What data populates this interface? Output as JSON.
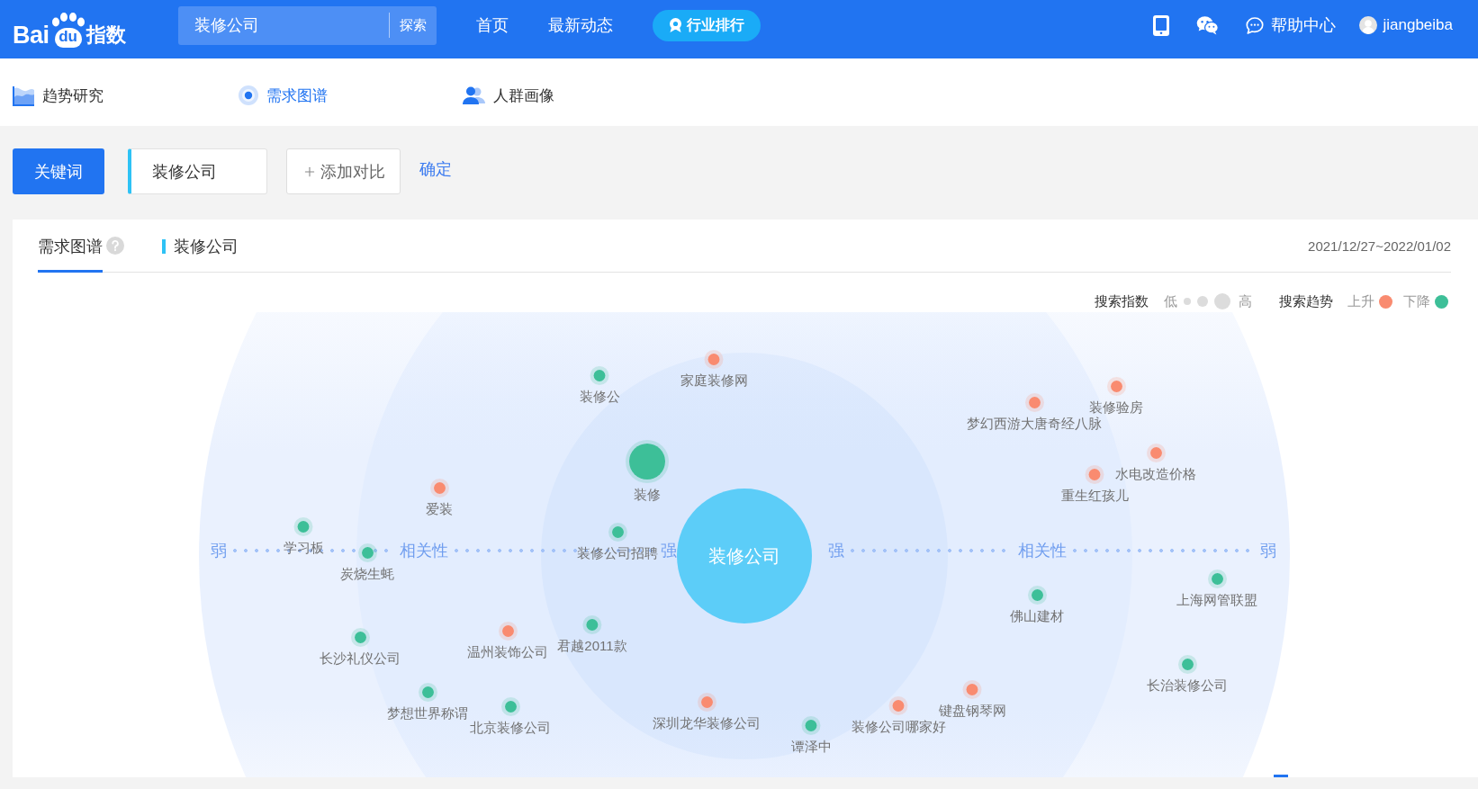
{
  "header": {
    "logo": {
      "lead": "Bai",
      "badge": "du",
      "tail": "指数"
    },
    "search": {
      "value": "装修公司",
      "button": "探索"
    },
    "nav": [
      "首页",
      "最新动态"
    ],
    "ranking_button": "行业排行",
    "help_link": "帮助中心",
    "user": "jiangbeiba"
  },
  "subnav": [
    {
      "label": "趋势研究",
      "selected": false
    },
    {
      "label": "需求图谱",
      "selected": true
    },
    {
      "label": "人群画像",
      "selected": false
    }
  ],
  "toolbar": {
    "keyword_button": "关键词",
    "keyword": "装修公司",
    "add_button": "添加对比",
    "confirm_link": "确定"
  },
  "panel": {
    "tabs": [
      {
        "label": "需求图谱",
        "kind": "help",
        "selected": true
      },
      {
        "label": "装修公司",
        "kind": "series",
        "selected": false
      }
    ],
    "date_range": "2021/12/27~2022/01/02",
    "legend": {
      "index_title": "搜索指数",
      "low": "低",
      "high": "高",
      "trend_title": "搜索趋势",
      "rising": {
        "label": "上升",
        "color": "#f98b70"
      },
      "falling": {
        "label": "下降",
        "color": "#3dbf98"
      }
    },
    "chart": {
      "axis": {
        "left": [
          "弱",
          "相关性",
          "强"
        ],
        "right": [
          "强",
          "相关性",
          "弱"
        ]
      },
      "center_keyword": "装修公司",
      "nodes": [
        {
          "label": "家庭装修网",
          "color": "#f98b70",
          "kind": "small"
        },
        {
          "label": "装修公",
          "color": "#3dbf98",
          "kind": "small"
        },
        {
          "label": "装修验房",
          "color": "#f98b70",
          "kind": "small"
        },
        {
          "label": "梦幻西游大唐奇经八脉",
          "color": "#f98b70",
          "kind": "small"
        },
        {
          "label": "水电改造价格",
          "color": "#f98b70",
          "kind": "small"
        },
        {
          "label": "装修",
          "color": "#3dbf98",
          "kind": "large"
        },
        {
          "label": "重生红孩儿",
          "color": "#f98b70",
          "kind": "small"
        },
        {
          "label": "爱装",
          "color": "#f98b70",
          "kind": "small"
        },
        {
          "label": "学习板",
          "color": "#3dbf98",
          "kind": "small"
        },
        {
          "label": "装修公司招聘",
          "color": "#3dbf98",
          "kind": "small"
        },
        {
          "label": "炭烧生蚝",
          "color": "#3dbf98",
          "kind": "small"
        },
        {
          "label": "上海网管联盟",
          "color": "#3dbf98",
          "kind": "small"
        },
        {
          "label": "佛山建材",
          "color": "#3dbf98",
          "kind": "small"
        },
        {
          "label": "长沙礼仪公司",
          "color": "#3dbf98",
          "kind": "small"
        },
        {
          "label": "温州装饰公司",
          "color": "#f98b70",
          "kind": "small"
        },
        {
          "label": "君越2011款",
          "color": "#3dbf98",
          "kind": "small"
        },
        {
          "label": "长治装修公司",
          "color": "#3dbf98",
          "kind": "small"
        },
        {
          "label": "梦想世界称谓",
          "color": "#3dbf98",
          "kind": "small"
        },
        {
          "label": "北京装修公司",
          "color": "#3dbf98",
          "kind": "small"
        },
        {
          "label": "深圳龙华装修公司",
          "color": "#f98b70",
          "kind": "small"
        },
        {
          "label": "装修公司哪家好",
          "color": "#f98b70",
          "kind": "small"
        },
        {
          "label": "键盘钢琴网",
          "color": "#f98b70",
          "kind": "small"
        },
        {
          "label": "谭泽中",
          "color": "#3dbf98",
          "kind": "small"
        }
      ]
    }
  }
}
